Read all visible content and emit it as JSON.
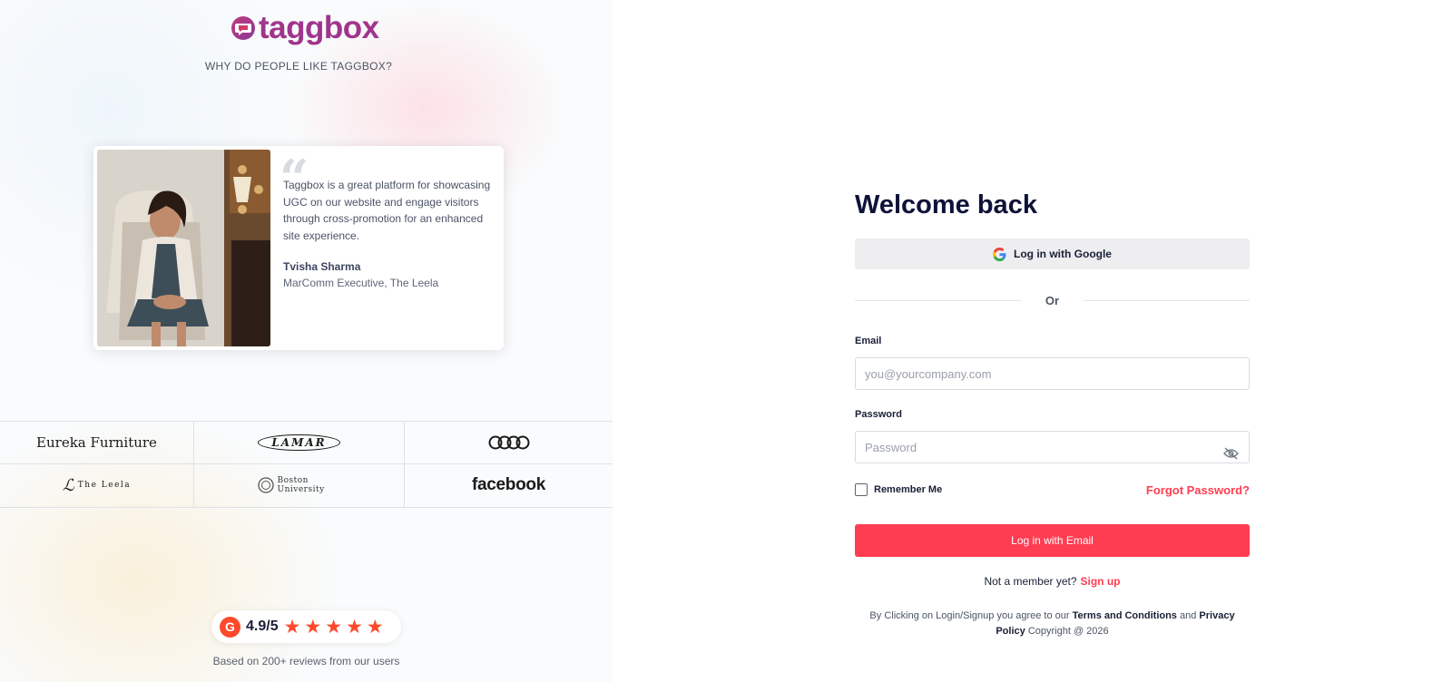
{
  "brand": {
    "logo_text": "taggbox",
    "tagline": "WHY DO PEOPLE LIKE TAGGBOX?"
  },
  "testimonial": {
    "quote": "Taggbox is a great platform for showcasing UGC on our website and engage visitors through cross-promotion for an enhanced site experience.",
    "name": "Tvisha Sharma",
    "role": "MarComm Executive, The Leela"
  },
  "client_logos": [
    "Eureka Furniture",
    "LAMAR",
    "Audi",
    "The Leela",
    "Boston University",
    "facebook"
  ],
  "rating": {
    "badge": "G",
    "score": "4.9/5",
    "stars": 5,
    "caption": "Based on 200+ reviews from our users"
  },
  "login": {
    "title": "Welcome back",
    "google_label": "Log in with Google",
    "divider": "Or",
    "email_label": "Email",
    "email_placeholder": "you@yourcompany.com",
    "password_label": "Password",
    "password_placeholder": "Password",
    "remember_label": "Remember Me",
    "forgot_label": "Forgot Password?",
    "submit_label": "Log in with Email",
    "member_text": "Not a member yet?",
    "signup_label": "Sign up",
    "legal_prefix": "By Clicking on Login/Signup you agree to our",
    "terms_label": "Terms and Conditions",
    "legal_and": "and",
    "privacy_label": "Privacy Policy",
    "copyright": "Copyright @ 2026"
  },
  "colors": {
    "accent": "#ff3d52",
    "brand_purple": "#a0358c",
    "g2_orange": "#ff492c",
    "heading": "#0e1238"
  },
  "icons": [
    "chat-bubble-logo-icon",
    "quote-icon",
    "g2-icon",
    "star-icon",
    "google-icon",
    "eye-off-icon"
  ]
}
